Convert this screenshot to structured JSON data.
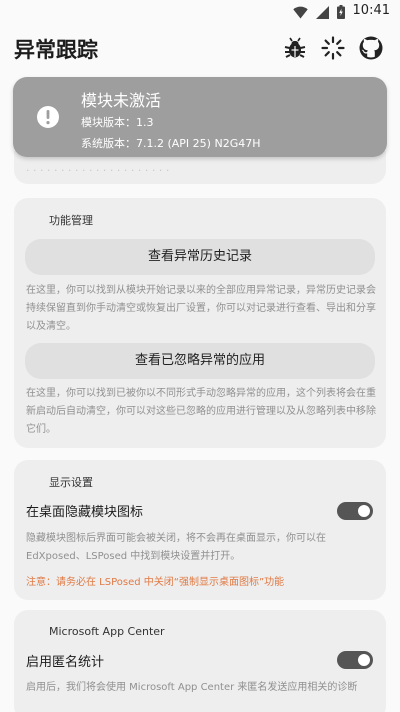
{
  "status_bar": {
    "time": "10:41"
  },
  "app": {
    "title": "异常跟踪"
  },
  "module_status": {
    "title": "模块未激活",
    "version_line": "模块版本：1.3",
    "system_line": "系统版本：7.1.2 (API 25) N2G47H"
  },
  "function_section": {
    "header": "功能管理",
    "history_button": "查看异常历史记录",
    "history_desc": "在这里，你可以找到从模块开始记录以来的全部应用异常记录，异常历史记录会持续保留直到你手动清空或恢复出厂设置，你可以对记录进行查看、导出和分享以及清空。",
    "ignored_button": "查看已忽略异常的应用",
    "ignored_desc": "在这里，你可以找到已被你以不同形式手动忽略异常的应用，这个列表将会在重新启动后自动清空，你可以对这些已忽略的应用进行管理以及从忽略列表中移除它们。"
  },
  "display_section": {
    "header": "显示设置",
    "hide_icon_label": "在桌面隐藏模块图标",
    "hide_icon_desc": "隐藏模块图标后界面可能会被关闭，将不会再在桌面显示，你可以在 EdXposed、LSPosed 中找到模块设置并打开。",
    "hide_icon_warning": "注意：请务必在 LSPosed 中关闭“强制显示桌面图标”功能",
    "hide_icon_enabled": true
  },
  "appcenter_section": {
    "header": "Microsoft App Center",
    "anon_label": "启用匿名统计",
    "anon_desc": "启用后，我们将会使用 Microsoft App Center 来匿名发送应用相关的诊断",
    "anon_enabled": true
  },
  "icons": {
    "bug": "bug-icon",
    "loading": "spinner-icon",
    "github": "github-icon",
    "alert": "alert-circle-icon"
  }
}
